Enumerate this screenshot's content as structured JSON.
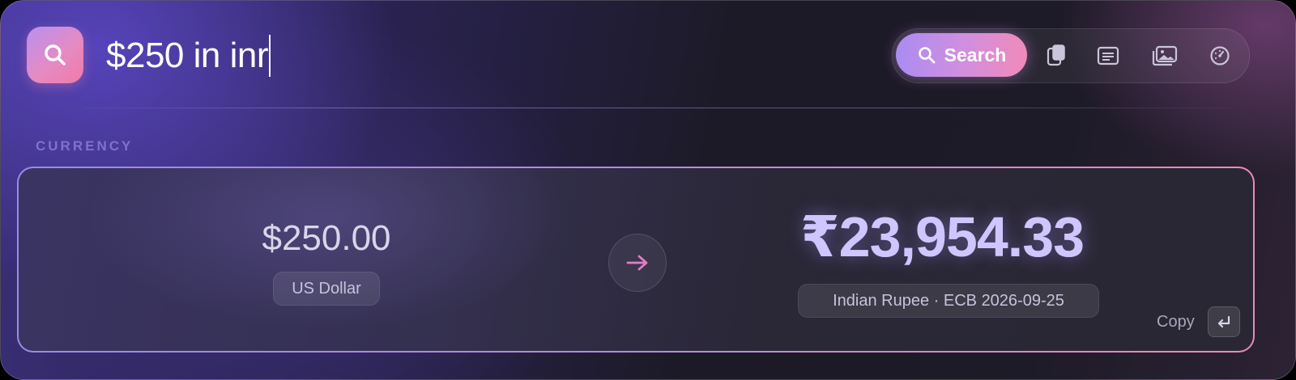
{
  "search": {
    "query": "$250 in inr",
    "button_label": "Search",
    "icon": "search-icon"
  },
  "toolbar": {
    "tools": [
      "clipboard-icon",
      "notes-icon",
      "images-icon",
      "gauge-icon"
    ]
  },
  "section": {
    "label": "CURRENCY"
  },
  "conversion": {
    "from_amount": "$250.00",
    "from_currency": "US Dollar",
    "to_amount": "₹23,954.33",
    "to_detail": "Indian Rupee · ECB 2026-09-25",
    "copy_label": "Copy",
    "copy_key": "enter-key-icon"
  },
  "colors": {
    "accent_purple": "#a98cf2",
    "accent_pink": "#f07aa8",
    "result_text": "#cfc6ff",
    "section_label": "#7f72c9"
  }
}
